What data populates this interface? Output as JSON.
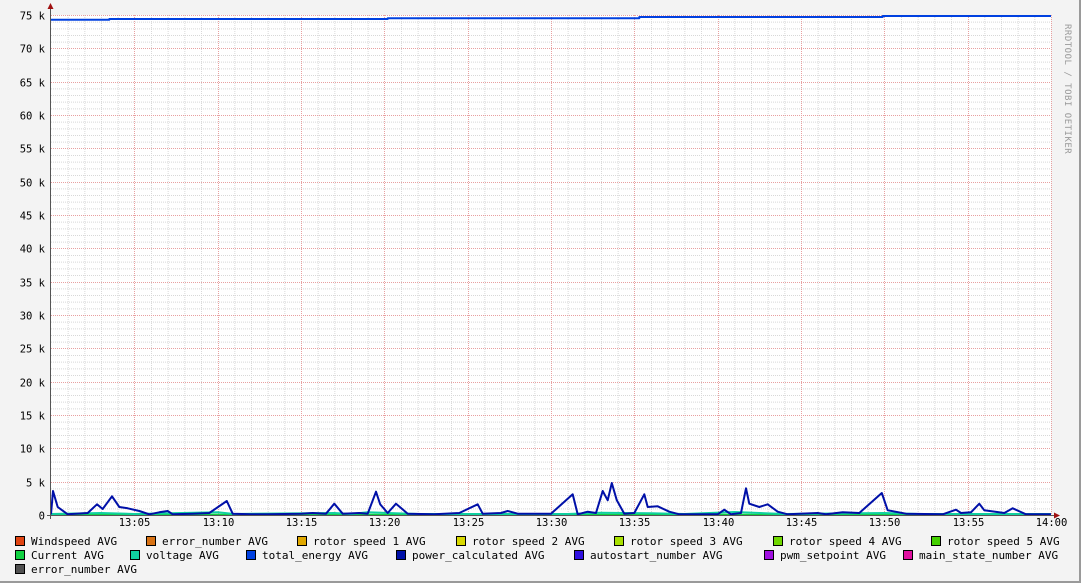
{
  "chart_data": {
    "type": "line",
    "title": "",
    "xlabel": "",
    "ylabel": "",
    "watermark": "RRDTOOL / TOBI OETIKER",
    "x_range_minutes": [
      0,
      60
    ],
    "x_ticks": [
      {
        "t": 5,
        "label": "13:05"
      },
      {
        "t": 10,
        "label": "13:10"
      },
      {
        "t": 15,
        "label": "13:15"
      },
      {
        "t": 20,
        "label": "13:20"
      },
      {
        "t": 25,
        "label": "13:25"
      },
      {
        "t": 30,
        "label": "13:30"
      },
      {
        "t": 35,
        "label": "13:35"
      },
      {
        "t": 40,
        "label": "13:40"
      },
      {
        "t": 45,
        "label": "13:45"
      },
      {
        "t": 50,
        "label": "13:50"
      },
      {
        "t": 55,
        "label": "13:55"
      },
      {
        "t": 60,
        "label": "14:00"
      }
    ],
    "ylim": [
      0,
      75000
    ],
    "y_ticks": [
      {
        "v": 0,
        "label": "0"
      },
      {
        "v": 5000,
        "label": "5 k"
      },
      {
        "v": 10000,
        "label": "10 k"
      },
      {
        "v": 15000,
        "label": "15 k"
      },
      {
        "v": 20000,
        "label": "20 k"
      },
      {
        "v": 25000,
        "label": "25 k"
      },
      {
        "v": 30000,
        "label": "30 k"
      },
      {
        "v": 35000,
        "label": "35 k"
      },
      {
        "v": 40000,
        "label": "40 k"
      },
      {
        "v": 45000,
        "label": "45 k"
      },
      {
        "v": 50000,
        "label": "50 k"
      },
      {
        "v": 55000,
        "label": "55 k"
      },
      {
        "v": 60000,
        "label": "60 k"
      },
      {
        "v": 65000,
        "label": "65 k"
      },
      {
        "v": 70000,
        "label": "70 k"
      },
      {
        "v": 75000,
        "label": "75 k"
      }
    ],
    "grid": true,
    "legend_placement": "bottom",
    "series": [
      {
        "name": "Windspeed AVG",
        "color": "#e04412",
        "points": []
      },
      {
        "name": "error_number AVG",
        "color": "#d87214",
        "points": []
      },
      {
        "name": "rotor speed 1 AVG",
        "color": "#e0a800",
        "points": []
      },
      {
        "name": "rotor speed 2 AVG",
        "color": "#d8d800",
        "points": []
      },
      {
        "name": "rotor speed 3 AVG",
        "color": "#a8e000",
        "points": []
      },
      {
        "name": "rotor speed 4 AVG",
        "color": "#70d800",
        "points": []
      },
      {
        "name": "rotor speed 5 AVG",
        "color": "#44d000",
        "points": []
      },
      {
        "name": "Current AVG",
        "color": "#10d040",
        "points": [
          [
            0,
            50
          ],
          [
            60,
            50
          ]
        ]
      },
      {
        "name": "voltage AVG",
        "color": "#10d0a0",
        "points": [
          [
            0,
            150
          ],
          [
            3,
            300
          ],
          [
            5,
            150
          ],
          [
            10,
            400
          ],
          [
            11,
            150
          ],
          [
            17,
            300
          ],
          [
            18,
            150
          ],
          [
            19,
            400
          ],
          [
            22,
            150
          ],
          [
            31,
            150
          ],
          [
            33,
            350
          ],
          [
            36,
            250
          ],
          [
            38,
            150
          ],
          [
            41,
            450
          ],
          [
            44,
            150
          ],
          [
            50,
            300
          ],
          [
            52,
            150
          ],
          [
            60,
            150
          ]
        ]
      },
      {
        "name": "total_energy AVG",
        "color": "#0040e0",
        "points": [
          [
            0,
            74300
          ],
          [
            3.5,
            74300
          ],
          [
            3.5,
            74400
          ],
          [
            20.2,
            74400
          ],
          [
            20.2,
            74500
          ],
          [
            35.3,
            74500
          ],
          [
            35.3,
            74700
          ],
          [
            49.9,
            74700
          ],
          [
            49.9,
            74850
          ],
          [
            60,
            74850
          ]
        ]
      },
      {
        "name": "power_calculated AVG",
        "color": "#0010a8",
        "points": [
          [
            0,
            100
          ],
          [
            0.12,
            3600
          ],
          [
            0.4,
            1200
          ],
          [
            1,
            100
          ],
          [
            2.2,
            300
          ],
          [
            2.76,
            1600
          ],
          [
            3.1,
            900
          ],
          [
            3.66,
            2800
          ],
          [
            4.1,
            1200
          ],
          [
            4.6,
            1000
          ],
          [
            5.3,
            600
          ],
          [
            5.9,
            100
          ],
          [
            6.5,
            400
          ],
          [
            7,
            600
          ],
          [
            7.3,
            100
          ],
          [
            8.5,
            200
          ],
          [
            9.5,
            300
          ],
          [
            10.55,
            2100
          ],
          [
            10.9,
            200
          ],
          [
            12,
            100
          ],
          [
            13,
            100
          ],
          [
            15,
            200
          ],
          [
            15.7,
            300
          ],
          [
            16.5,
            200
          ],
          [
            17,
            1700
          ],
          [
            17.5,
            200
          ],
          [
            18.5,
            300
          ],
          [
            19,
            200
          ],
          [
            19.5,
            3500
          ],
          [
            19.75,
            1600
          ],
          [
            20.2,
            300
          ],
          [
            20.7,
            1700
          ],
          [
            21.4,
            200
          ],
          [
            23,
            100
          ],
          [
            24.5,
            300
          ],
          [
            25.6,
            1600
          ],
          [
            25.9,
            200
          ],
          [
            27,
            300
          ],
          [
            27.4,
            600
          ],
          [
            28,
            200
          ],
          [
            30,
            200
          ],
          [
            31.3,
            3100
          ],
          [
            31.6,
            100
          ],
          [
            32.2,
            500
          ],
          [
            32.7,
            300
          ],
          [
            33.1,
            3600
          ],
          [
            33.4,
            2200
          ],
          [
            33.65,
            4800
          ],
          [
            33.95,
            2200
          ],
          [
            34.4,
            200
          ],
          [
            35,
            300
          ],
          [
            35.6,
            3100
          ],
          [
            35.8,
            1200
          ],
          [
            36.4,
            1300
          ],
          [
            37.1,
            500
          ],
          [
            37.7,
            100
          ],
          [
            40,
            100
          ],
          [
            40.4,
            800
          ],
          [
            40.8,
            100
          ],
          [
            41.4,
            300
          ],
          [
            41.7,
            4000
          ],
          [
            41.9,
            1700
          ],
          [
            42.5,
            1200
          ],
          [
            43,
            1600
          ],
          [
            43.6,
            500
          ],
          [
            44.2,
            100
          ],
          [
            46,
            300
          ],
          [
            46.5,
            100
          ],
          [
            47.5,
            400
          ],
          [
            48.5,
            300
          ],
          [
            49.85,
            3300
          ],
          [
            50.2,
            700
          ],
          [
            51.3,
            200
          ],
          [
            53.5,
            100
          ],
          [
            54.3,
            800
          ],
          [
            54.6,
            300
          ],
          [
            55.2,
            400
          ],
          [
            55.7,
            1700
          ],
          [
            56,
            700
          ],
          [
            57.2,
            300
          ],
          [
            57.7,
            1000
          ],
          [
            58.5,
            100
          ],
          [
            60,
            100
          ]
        ]
      },
      {
        "name": "autostart_number AVG",
        "color": "#3010e0",
        "points": []
      },
      {
        "name": "pwm_setpoint AVG",
        "color": "#a010e0",
        "points": []
      },
      {
        "name": "main_state_number AVG",
        "color": "#e010a0",
        "points": []
      },
      {
        "name": "error_number AVG",
        "color": "#505050",
        "points": []
      }
    ]
  }
}
